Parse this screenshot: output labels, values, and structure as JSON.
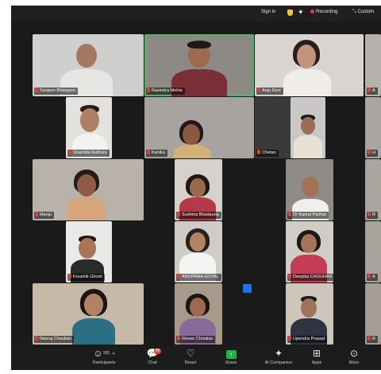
{
  "top_bar": {
    "sign_in": "Sign in",
    "recording": "Recording",
    "custom": "Custom"
  },
  "participants": [
    {
      "name": "Sanjeev Bhargava",
      "bg": "#cfcfcd"
    },
    {
      "name": "Ravindra Mehta",
      "bg": "#8d8a86"
    },
    {
      "name": "Anju Devi",
      "bg": "#d9d4cf"
    },
    {
      "name": "A",
      "bg": "#b5b1ac"
    },
    {
      "name": "Sharmila Rathore",
      "bg": "#e4e2df"
    },
    {
      "name": "Kanika",
      "bg": "#a8a39e"
    },
    {
      "name": "Chetan",
      "bg": "#c9c8c6"
    },
    {
      "name": "H",
      "bg": "#a9a5a1"
    },
    {
      "name": "Manju",
      "bg": "#b8b2aa"
    },
    {
      "name": "Sushma Bhadauria",
      "bg": "#d6d1cb"
    },
    {
      "name": "Dr Kamal Parihar",
      "bg": "#8e8b88"
    },
    {
      "name": "R",
      "bg": "#aba6a0"
    },
    {
      "name": "Koushik Ghosh",
      "bg": "#e9e9e8"
    },
    {
      "name": "ANUPAMA GOYAL",
      "bg": "#cfcbc6"
    },
    {
      "name": "Deepika CHOUHAN",
      "bg": "#d0ccc6"
    },
    {
      "name": "A",
      "bg": "#a9a39d"
    },
    {
      "name": "Neeraj Chauhan",
      "bg": "#c7b9a7"
    },
    {
      "name": "Renee Christian",
      "bg": "#a89a8a"
    },
    {
      "name": "Upendra Prasad",
      "bg": "#cfc6bb"
    },
    {
      "name": "R",
      "bg": "#a59e97"
    }
  ],
  "toolbar": {
    "participants_label": "Participants",
    "participants_count": "185",
    "chat_label": "Chat",
    "chat_badge": "99",
    "react_label": "React",
    "share_label": "Share",
    "ai_label": "AI Companion",
    "apps_label": "Apps",
    "more_label": "More"
  },
  "colors": {
    "active_speaker": "#34c759",
    "mic_muted": "#e0453a",
    "share": "#21b04c"
  }
}
